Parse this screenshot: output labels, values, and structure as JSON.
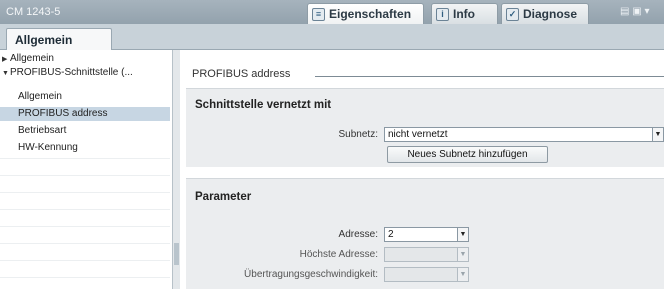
{
  "window": {
    "title": "CM 1243-5",
    "tabs": [
      {
        "label": "Eigenschaften",
        "icon": "properties-icon",
        "glyph": "≡"
      },
      {
        "label": "Info",
        "icon": "info-icon",
        "glyph": "i"
      },
      {
        "label": "Diagnose",
        "icon": "diagnostics-icon",
        "glyph": "✓"
      }
    ],
    "controls": "▤ ▣ ▾"
  },
  "tabstrip": {
    "active_tab": "Allgemein"
  },
  "tree": {
    "items": [
      {
        "label": "Allgemein",
        "arrow": "▶"
      },
      {
        "label": "PROFIBUS-Schnittstelle (...",
        "arrow": "▼"
      },
      {
        "label": "Allgemein"
      },
      {
        "label": "PROFIBUS address"
      },
      {
        "label": "Betriebsart"
      },
      {
        "label": "HW-Kennung"
      }
    ],
    "selected_index": 3
  },
  "main": {
    "heading": "PROFIBUS address",
    "network_section": {
      "title": "Schnittstelle vernetzt mit",
      "subnet_label": "Subnetz:",
      "subnet_value": "nicht vernetzt",
      "add_subnet_button": "Neues Subnetz hinzufügen"
    },
    "parameter_section": {
      "title": "Parameter",
      "address_label": "Adresse:",
      "address_value": "2",
      "highest_address_label": "Höchste Adresse:",
      "highest_address_value": "",
      "transmission_speed_label": "Übertragungsgeschwindigkeit:",
      "transmission_speed_value": ""
    }
  },
  "glyphs": {
    "dropdown": "▼"
  }
}
